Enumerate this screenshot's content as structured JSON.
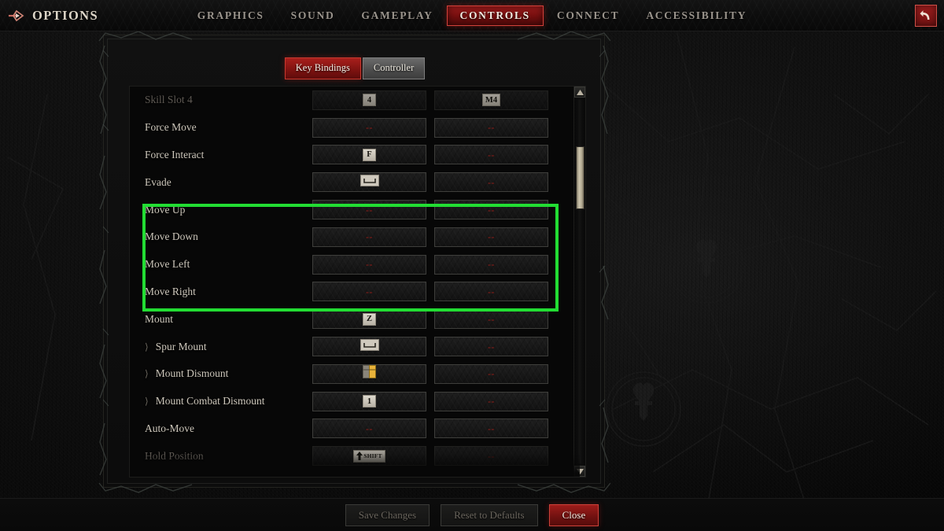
{
  "header": {
    "options_label": "OPTIONS",
    "options_icon": "arrow-diamond-icon",
    "close_icon": "back-arrow-icon",
    "tabs": [
      {
        "label": "GRAPHICS",
        "active": false
      },
      {
        "label": "SOUND",
        "active": false
      },
      {
        "label": "GAMEPLAY",
        "active": false
      },
      {
        "label": "CONTROLS",
        "active": true
      },
      {
        "label": "CONNECT",
        "active": false
      },
      {
        "label": "ACCESSIBILITY",
        "active": false
      }
    ]
  },
  "subtabs": [
    {
      "label": "Key Bindings",
      "active": true
    },
    {
      "label": "Controller",
      "active": false
    }
  ],
  "bindings": {
    "rows": [
      {
        "label": "Skill Slot 4",
        "indent": false,
        "dim": true,
        "primary": {
          "type": "key",
          "text": "4"
        },
        "secondary": {
          "type": "key",
          "text": "M4"
        }
      },
      {
        "label": "Force Move",
        "indent": false,
        "dim": false,
        "primary": {
          "type": "empty",
          "text": "--"
        },
        "secondary": {
          "type": "empty",
          "text": "--"
        }
      },
      {
        "label": "Force Interact",
        "indent": false,
        "dim": false,
        "primary": {
          "type": "key",
          "text": "F"
        },
        "secondary": {
          "type": "empty",
          "text": "--"
        }
      },
      {
        "label": "Evade",
        "indent": false,
        "dim": false,
        "primary": {
          "type": "spacebar",
          "text": ""
        },
        "secondary": {
          "type": "empty",
          "text": "--"
        }
      },
      {
        "label": "Move Up",
        "indent": false,
        "dim": false,
        "primary": {
          "type": "empty",
          "text": "--"
        },
        "secondary": {
          "type": "empty",
          "text": "--"
        }
      },
      {
        "label": "Move Down",
        "indent": false,
        "dim": false,
        "primary": {
          "type": "empty",
          "text": "--"
        },
        "secondary": {
          "type": "empty",
          "text": "--"
        }
      },
      {
        "label": "Move Left",
        "indent": false,
        "dim": false,
        "primary": {
          "type": "empty",
          "text": "--"
        },
        "secondary": {
          "type": "empty",
          "text": "--"
        }
      },
      {
        "label": "Move Right",
        "indent": false,
        "dim": false,
        "primary": {
          "type": "empty",
          "text": "--"
        },
        "secondary": {
          "type": "empty",
          "text": "--"
        }
      },
      {
        "label": "Mount",
        "indent": false,
        "dim": false,
        "primary": {
          "type": "key",
          "text": "Z"
        },
        "secondary": {
          "type": "empty",
          "text": "--"
        }
      },
      {
        "label": "Spur Mount",
        "indent": true,
        "dim": false,
        "primary": {
          "type": "spacebar",
          "text": ""
        },
        "secondary": {
          "type": "empty",
          "text": "--"
        }
      },
      {
        "label": "Mount Dismount",
        "indent": true,
        "dim": false,
        "primary": {
          "type": "mouse",
          "text": ""
        },
        "secondary": {
          "type": "empty",
          "text": "--"
        }
      },
      {
        "label": "Mount Combat Dismount",
        "indent": true,
        "dim": false,
        "primary": {
          "type": "key",
          "text": "1"
        },
        "secondary": {
          "type": "empty",
          "text": "--"
        }
      },
      {
        "label": "Auto-Move",
        "indent": false,
        "dim": false,
        "primary": {
          "type": "empty",
          "text": "--"
        },
        "secondary": {
          "type": "empty",
          "text": "--"
        }
      },
      {
        "label": "Hold Position",
        "indent": false,
        "dim": true,
        "primary": {
          "type": "shift",
          "text": "SHIFT"
        },
        "secondary": {
          "type": "empty",
          "text": "--"
        }
      }
    ]
  },
  "highlight": {
    "color": "#22dd33",
    "rows": [
      "Move Up",
      "Move Down",
      "Move Left",
      "Move Right"
    ]
  },
  "scrollbar": {
    "up_icon": "scroll-up-arrow-icon",
    "down_icon": "scroll-down-arrow-icon"
  },
  "footer": {
    "save_label": "Save Changes",
    "reset_label": "Reset to Defaults",
    "close_label": "Close"
  },
  "colors": {
    "accent_red": "#a81f1c",
    "highlight_green": "#22dd33",
    "text_light": "#cdc7bb",
    "empty_binding": "#8b1d18"
  }
}
